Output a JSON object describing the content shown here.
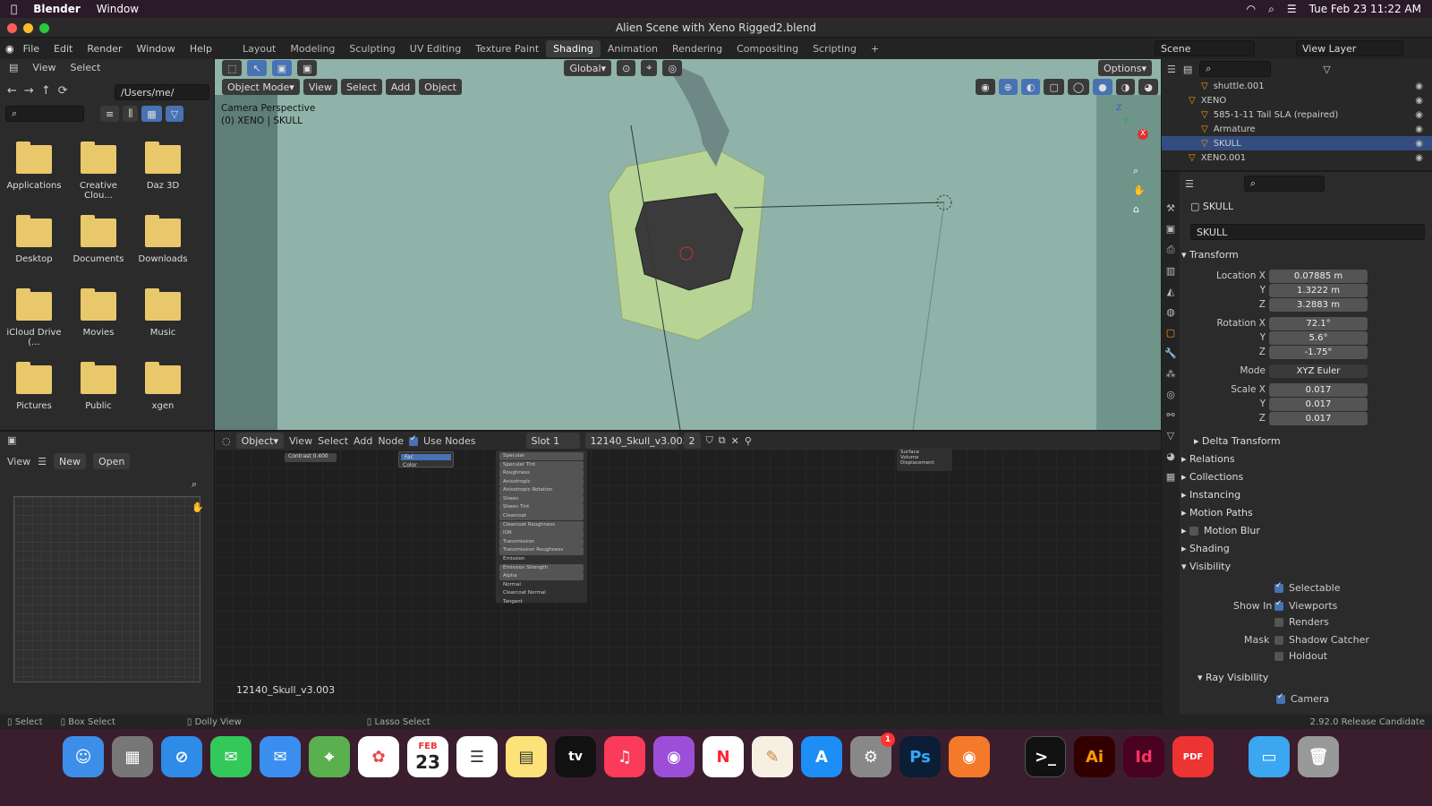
{
  "menubar": {
    "app": "Blender",
    "items": [
      "Window"
    ],
    "clock": "Tue Feb 23  11:22 AM"
  },
  "window": {
    "title": "Alien Scene with Xeno Rigged2.blend"
  },
  "topbar": {
    "menus": [
      "File",
      "Edit",
      "Render",
      "Window",
      "Help"
    ],
    "workspaces": [
      "Layout",
      "Modeling",
      "Sculpting",
      "UV Editing",
      "Texture Paint",
      "Shading",
      "Animation",
      "Rendering",
      "Compositing",
      "Scripting"
    ],
    "active_workspace": "Shading",
    "scene_label": "Scene",
    "view_layer_label": "View Layer"
  },
  "filebrowser": {
    "header_menus": [
      "View",
      "Select"
    ],
    "path": "/Users/me/",
    "folders": [
      "Applications",
      "Creative Clou...",
      "Daz 3D",
      "Desktop",
      "Documents",
      "Downloads",
      "iCloud Drive (...",
      "Movies",
      "Music",
      "Pictures",
      "Public",
      "xgen"
    ]
  },
  "imageeditor": {
    "view_label": "View",
    "new_label": "New",
    "open_label": "Open"
  },
  "viewport": {
    "mode": "Object Mode",
    "menus": [
      "View",
      "Select",
      "Add",
      "Object"
    ],
    "transform_orientation": "Global",
    "options_label": "Options",
    "overlay_line1": "Camera Perspective",
    "overlay_line2": "(0) XENO | SKULL",
    "gizmo": {
      "x": "X",
      "y": "Y",
      "z": "Z"
    }
  },
  "nodeeditor": {
    "type": "Object",
    "menus": [
      "View",
      "Select",
      "Add",
      "Node"
    ],
    "use_nodes_label": "Use Nodes",
    "slot": "Slot 1",
    "material": "12140_Skull_v3.003",
    "users": "2",
    "footer_material": "12140_Skull_v3.003",
    "bsdf_rows": [
      "Specular",
      "Specular Tint",
      "Roughness",
      "Anisotropic",
      "Anisotropic Rotation",
      "Sheen",
      "Sheen Tint",
      "Clearcoat",
      "Clearcoat Roughness",
      "IOR",
      "Transmission",
      "Transmission Roughness",
      "Emission",
      "Emission Strength",
      "Alpha",
      "Normal",
      "Clearcoat Normal",
      "Tangent"
    ],
    "output_rows": [
      "Surface",
      "Volume",
      "Displacement"
    ],
    "small_node_label": "Contrast",
    "small_node_value": "0.400",
    "fac_label": "Fac",
    "color_label": "Color"
  },
  "outliner": {
    "items": [
      {
        "name": "shuttle.001",
        "indent": 2
      },
      {
        "name": "XENO",
        "indent": 1
      },
      {
        "name": "585-1-11 Tail SLA (repaired)",
        "indent": 2
      },
      {
        "name": "Armature",
        "indent": 2
      },
      {
        "name": "SKULL",
        "indent": 2
      },
      {
        "name": "XENO.001",
        "indent": 1
      }
    ],
    "selected": "SKULL"
  },
  "properties": {
    "object_name": "SKULL",
    "object_field": "SKULL",
    "transform_label": "Transform",
    "location_label": "Location X",
    "rotation_label": "Rotation X",
    "scale_label": "Scale X",
    "y_label": "Y",
    "z_label": "Z",
    "location": [
      "0.07885 m",
      "1.3222 m",
      "3.2883 m"
    ],
    "rotation": [
      "72.1°",
      "5.6°",
      "-1.75°"
    ],
    "mode_label": "Mode",
    "mode": "XYZ Euler",
    "scale": [
      "0.017",
      "0.017",
      "0.017"
    ],
    "collapsed_panels": [
      "Delta Transform",
      "Relations",
      "Collections",
      "Instancing",
      "Motion Paths",
      "Motion Blur",
      "Shading"
    ],
    "visibility_label": "Visibility",
    "selectable_label": "Selectable",
    "show_in_label": "Show In",
    "viewports_label": "Viewports",
    "renders_label": "Renders",
    "mask_label": "Mask",
    "shadow_catcher_label": "Shadow Catcher",
    "holdout_label": "Holdout",
    "ray_visibility_label": "Ray Visibility",
    "camera_label": "Camera"
  },
  "statusbar": {
    "select": "Select",
    "box_select": "Box Select",
    "dolly_view": "Dolly View",
    "lasso_select": "Lasso Select",
    "version": "2.92.0 Release Candidate"
  },
  "dock": {
    "calendar_month": "FEB",
    "calendar_day": "23",
    "settings_badge": "1",
    "ps": "Ps",
    "ai": "Ai",
    "id": "Id",
    "pdf": "PDF",
    "appletv": "tv"
  }
}
